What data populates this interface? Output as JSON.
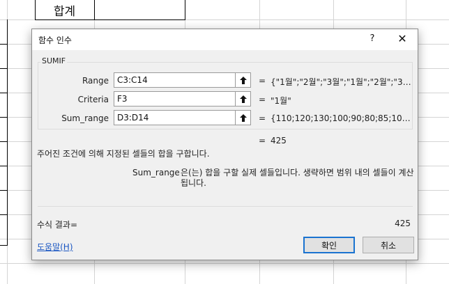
{
  "sheet": {
    "total_cell": "합계"
  },
  "dialog": {
    "title": "함수 인수",
    "help_glyph": "?",
    "close_glyph": "✕",
    "function_name": "SUMIF",
    "arguments": [
      {
        "label": "Range",
        "value": "C3:C14",
        "equals": "=",
        "result": "{\"1월\";\"2월\";\"3월\";\"1월\";\"2월\";\"3월\"..."
      },
      {
        "label": "Criteria",
        "value": "F3",
        "equals": "=",
        "result": "\"1월\""
      },
      {
        "label": "Sum_range",
        "value": "D3:D14",
        "equals": "=",
        "result": "{110;120;130;100;90;80;85;100;95..."
      }
    ],
    "result_equals": "=",
    "result_value": "425",
    "description": "주어진 조건에 의해 지정된 셀들의 합을 구합니다.",
    "param_name": "Sum_range",
    "param_description": "은(는) 합을 구할 실제 셀들입니다. 생략하면 범위 내의 셀들이 계산됩니다.",
    "formula_result_label": "수식 결과=",
    "formula_result_value": "425",
    "help_link": "도움말(H)",
    "ok_label": "확인",
    "cancel_label": "취소"
  },
  "icons": {
    "collapse": "collapse-dialog-icon",
    "close": "close-icon",
    "help": "help-icon"
  },
  "colors": {
    "link": "#1a56c2",
    "ok_border": "#1a73d0",
    "dialog_bg": "#f0f0f0"
  }
}
